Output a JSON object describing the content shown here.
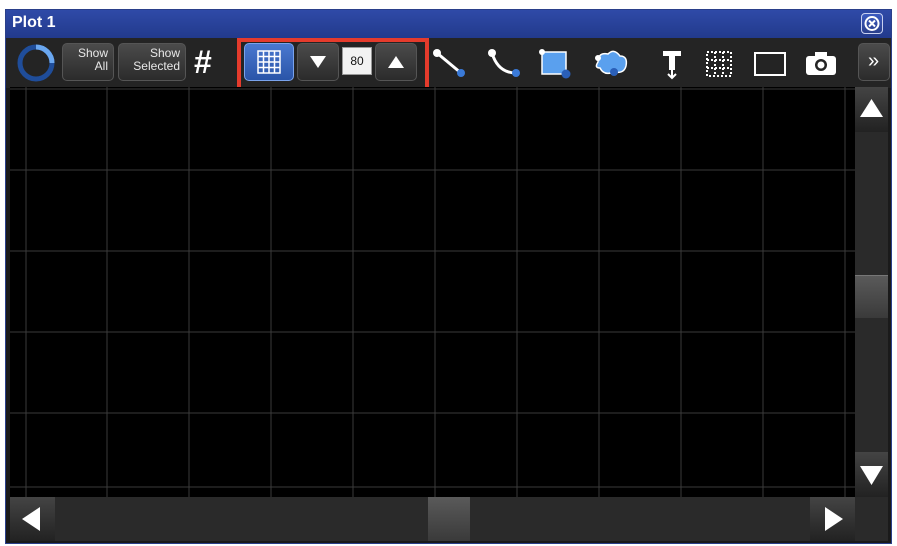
{
  "window": {
    "title": "Plot 1"
  },
  "toolbar": {
    "show_all": {
      "line1": "Show",
      "line2": "All"
    },
    "show_selected": {
      "line1": "Show",
      "line2": "Selected"
    },
    "grid_symbol": "#",
    "grid_size_value": "80",
    "more_label": "»"
  },
  "icons": {
    "rotate": "spinner-icon",
    "grid_toggle": "grid-icon",
    "decrease": "triangle-down-icon",
    "increase": "triangle-up-icon",
    "line_tool": "line-tool-icon",
    "curve_tool": "curve-tool-icon",
    "rect_tool": "rectangle-tool-icon",
    "cloud_tool": "cloud-tool-icon",
    "text_tool": "text-tool-icon",
    "dotted_grid": "dotted-grid-icon",
    "frame": "frame-icon",
    "camera": "camera-icon"
  },
  "colors": {
    "title_bar": "#2f4aa8",
    "highlight": "#e53b2c",
    "selected": "#3a66be",
    "plot_bg": "#000000",
    "grid_line": "#3a3a3a"
  }
}
